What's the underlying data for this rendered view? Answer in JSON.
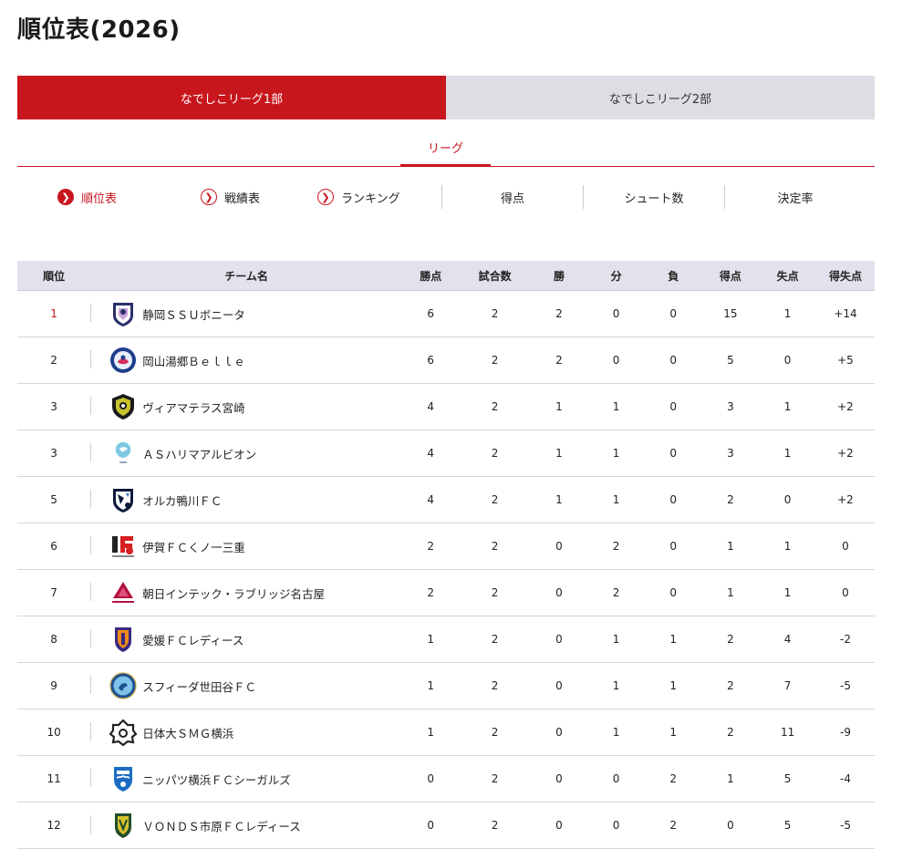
{
  "page": {
    "title": "順位表(2026)"
  },
  "league_tabs": [
    {
      "label": "なでしこリーグ1部",
      "active": true
    },
    {
      "label": "なでしこリーグ2部",
      "active": false
    }
  ],
  "sub_tab": {
    "label": "リーグ"
  },
  "views": [
    {
      "label": "順位表",
      "active": true
    },
    {
      "label": "戦績表",
      "active": false
    },
    {
      "label": "ランキング",
      "active": false
    }
  ],
  "stats": [
    {
      "label": "得点"
    },
    {
      "label": "シュート数"
    },
    {
      "label": "決定率"
    }
  ],
  "table": {
    "headers": [
      "順位",
      "チーム名",
      "勝点",
      "試合数",
      "勝",
      "分",
      "負",
      "得点",
      "失点",
      "得失点"
    ],
    "rows": [
      {
        "rank": "1",
        "team": "静岡ＳＳＵボニータ",
        "emblem": "bonita-emblem",
        "pts": "6",
        "played": "2",
        "w": "2",
        "d": "0",
        "l": "0",
        "gf": "15",
        "ga": "1",
        "gd": "+14"
      },
      {
        "rank": "2",
        "team": "岡山湯郷Ｂｅｌｌｅ",
        "emblem": "belle-emblem",
        "pts": "6",
        "played": "2",
        "w": "2",
        "d": "0",
        "l": "0",
        "gf": "5",
        "ga": "0",
        "gd": "+5"
      },
      {
        "rank": "3",
        "team": "ヴィアマテラス宮崎",
        "emblem": "viamateras-emblem",
        "pts": "4",
        "played": "2",
        "w": "1",
        "d": "1",
        "l": "0",
        "gf": "3",
        "ga": "1",
        "gd": "+2"
      },
      {
        "rank": "3",
        "team": "ＡＳハリマアルビオン",
        "emblem": "albion-emblem",
        "pts": "4",
        "played": "2",
        "w": "1",
        "d": "1",
        "l": "0",
        "gf": "3",
        "ga": "1",
        "gd": "+2"
      },
      {
        "rank": "5",
        "team": "オルカ鴨川ＦＣ",
        "emblem": "orca-emblem",
        "pts": "4",
        "played": "2",
        "w": "1",
        "d": "1",
        "l": "0",
        "gf": "2",
        "ga": "0",
        "gd": "+2"
      },
      {
        "rank": "6",
        "team": "伊賀ＦＣくノ一三重",
        "emblem": "iga-emblem",
        "pts": "2",
        "played": "2",
        "w": "0",
        "d": "2",
        "l": "0",
        "gf": "1",
        "ga": "1",
        "gd": "0"
      },
      {
        "rank": "7",
        "team": "朝日インテック・ラブリッジ名古屋",
        "emblem": "loveledge-emblem",
        "pts": "2",
        "played": "2",
        "w": "0",
        "d": "2",
        "l": "0",
        "gf": "1",
        "ga": "1",
        "gd": "0"
      },
      {
        "rank": "8",
        "team": "愛媛ＦＣレディース",
        "emblem": "ehime-emblem",
        "pts": "1",
        "played": "2",
        "w": "0",
        "d": "1",
        "l": "1",
        "gf": "2",
        "ga": "4",
        "gd": "-2"
      },
      {
        "rank": "9",
        "team": "スフィーダ世田谷ＦＣ",
        "emblem": "sfida-emblem",
        "pts": "1",
        "played": "2",
        "w": "0",
        "d": "1",
        "l": "1",
        "gf": "2",
        "ga": "7",
        "gd": "-5"
      },
      {
        "rank": "10",
        "team": "日体大ＳＭＧ横浜",
        "emblem": "nittaidai-emblem",
        "pts": "1",
        "played": "2",
        "w": "0",
        "d": "1",
        "l": "1",
        "gf": "2",
        "ga": "11",
        "gd": "-9"
      },
      {
        "rank": "11",
        "team": "ニッパツ横浜ＦＣシーガルズ",
        "emblem": "seagulls-emblem",
        "pts": "0",
        "played": "2",
        "w": "0",
        "d": "0",
        "l": "2",
        "gf": "1",
        "ga": "5",
        "gd": "-4"
      },
      {
        "rank": "12",
        "team": "ＶＯＮＤＳ市原ＦＣレディース",
        "emblem": "vonds-emblem",
        "pts": "0",
        "played": "2",
        "w": "0",
        "d": "0",
        "l": "2",
        "gf": "0",
        "ga": "5",
        "gd": "-5"
      }
    ]
  },
  "colors": {
    "accent": "#c8161d",
    "header_bg": "#e2e2ec",
    "inactive_tab": "#dddde4"
  }
}
